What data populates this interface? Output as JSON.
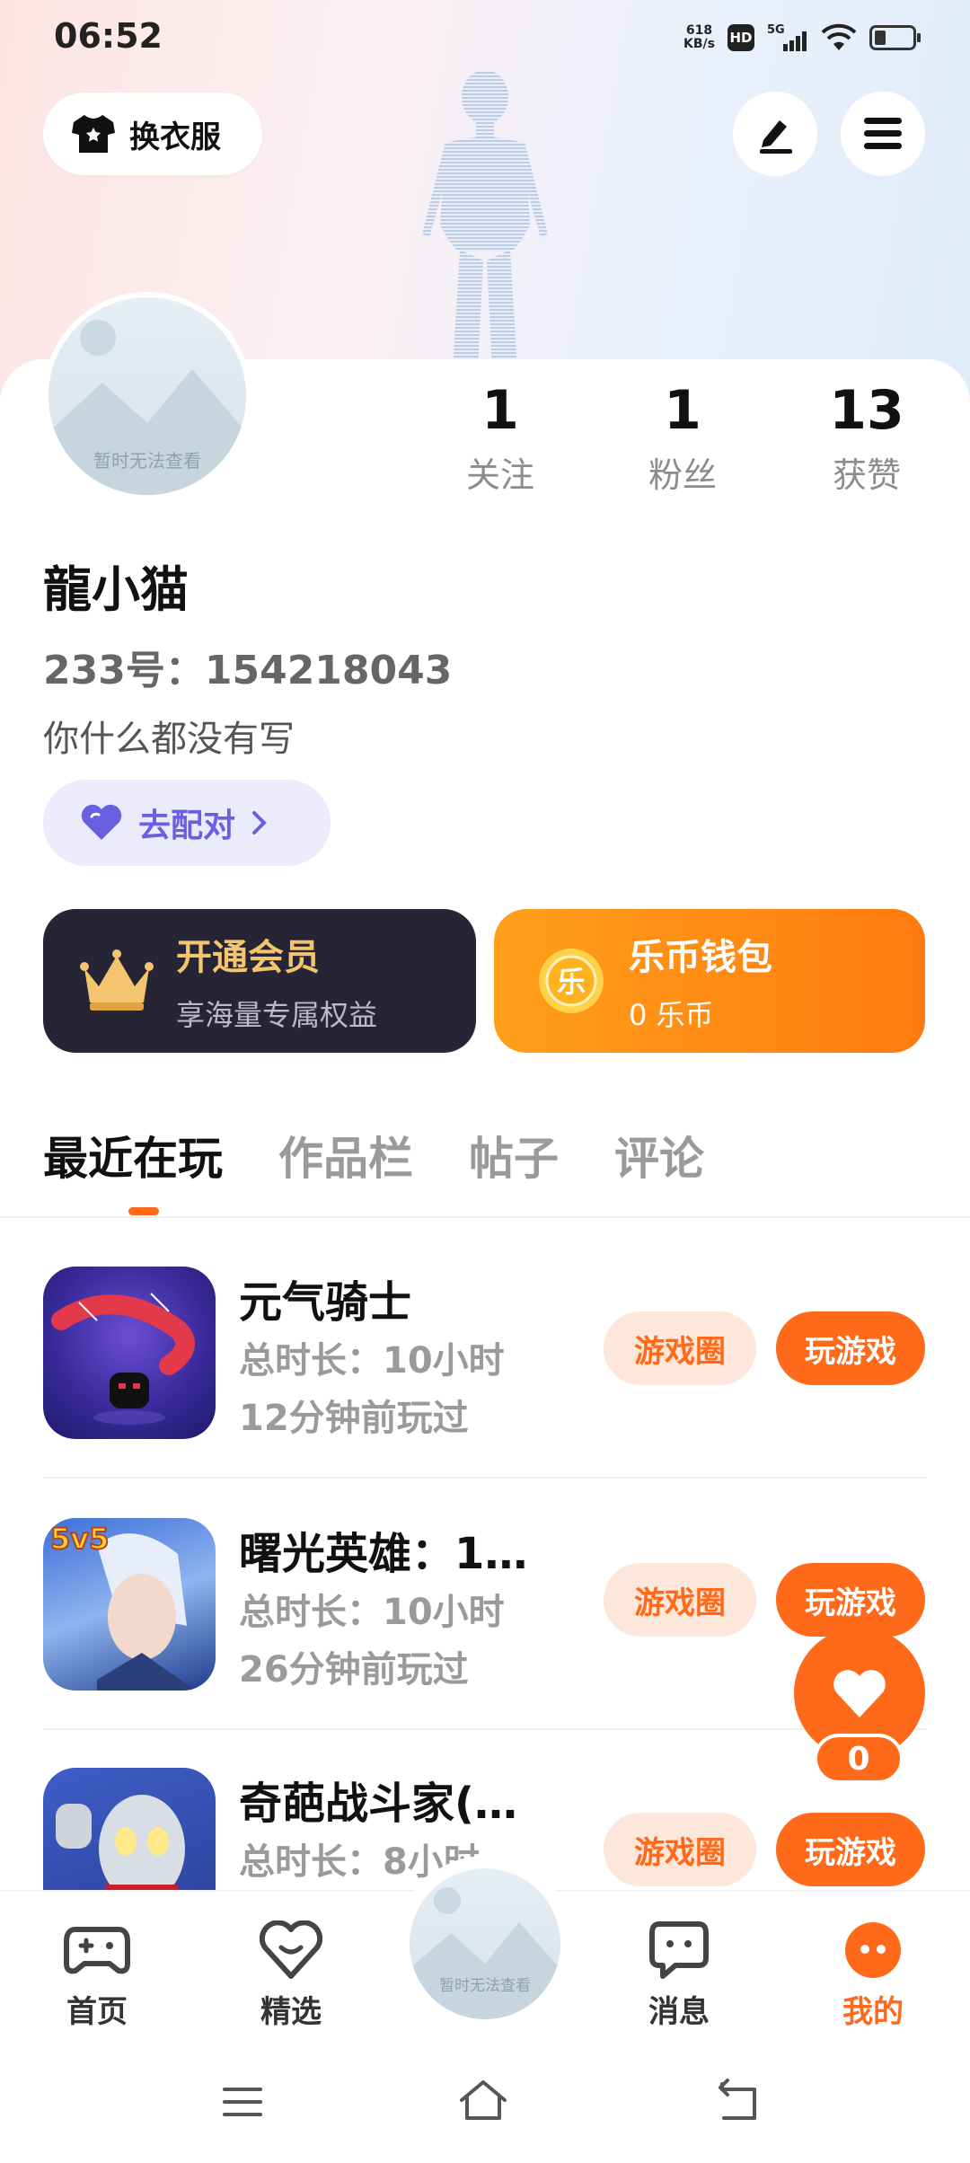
{
  "status_bar": {
    "time": "06:52",
    "net_speed_value": "618",
    "net_speed_unit": "KB/s",
    "hd": "HD",
    "signal": "5G"
  },
  "header": {
    "dress_label": "换衣服",
    "dress_icon": "shirt-icon",
    "edit_icon": "edit-icon",
    "menu_icon": "menu-icon"
  },
  "profile": {
    "avatar_placeholder": "暂时无法查看",
    "stats": [
      {
        "value": "1",
        "label": "关注"
      },
      {
        "value": "1",
        "label": "粉丝"
      },
      {
        "value": "13",
        "label": "获赞"
      }
    ],
    "name": "龍小猫",
    "id_text": "233号：154218043",
    "bio": "你什么都没有写",
    "pair_label": "去配对"
  },
  "cards": {
    "vip": {
      "title": "开通会员",
      "subtitle": "享海量专属权益"
    },
    "wallet": {
      "title": "乐币钱包",
      "subtitle": "0 乐币",
      "coin_glyph": "乐"
    }
  },
  "tabs": [
    "最近在玩",
    "作品栏",
    "帖子",
    "评论"
  ],
  "games": [
    {
      "name": "元气骑士",
      "duration": "总时长：10小时",
      "last_played": "12分钟前玩过",
      "circle_label": "游戏圈",
      "play_label": "玩游戏"
    },
    {
      "name": "曙光英雄：1…",
      "duration": "总时长：10小时",
      "last_played": "26分钟前玩过",
      "circle_label": "游戏圈",
      "play_label": "玩游戏",
      "badge": "5v5"
    },
    {
      "name": "奇葩战斗家(…",
      "duration": "总时长：8小时",
      "last_played": "",
      "circle_label": "游戏圈",
      "play_label": "玩游戏"
    }
  ],
  "like_float": {
    "count": "0"
  },
  "bottom_nav": {
    "items": [
      {
        "label": "首页",
        "icon": "gamepad-icon"
      },
      {
        "label": "精选",
        "icon": "heart-chat-icon"
      },
      {
        "label": "消息",
        "icon": "message-icon"
      },
      {
        "label": "我的",
        "icon": "profile-face-icon"
      }
    ],
    "center_avatar_placeholder": "暂时无法查看"
  },
  "colors": {
    "accent": "#ff6a1a",
    "pair_purple": "#6a5fe0",
    "vip_bg": "#262536",
    "vip_gold": "#f5c46e"
  }
}
